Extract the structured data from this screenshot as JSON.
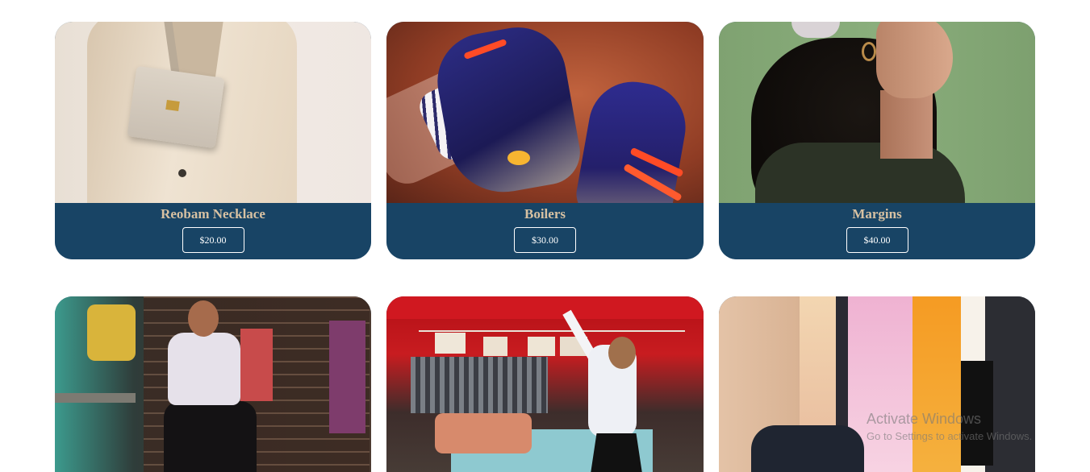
{
  "products": [
    {
      "name": "Reobam Necklace",
      "price": "$20.00"
    },
    {
      "name": "Boilers",
      "price": "$30.00"
    },
    {
      "name": "Margins",
      "price": "$40.00"
    }
  ],
  "images": [
    "jacket-bag-photo",
    "sneakers-photo",
    "woman-earring-photo",
    "market-woman-photo",
    "red-tent-market-photo",
    "scarves-photo"
  ],
  "colors": {
    "card_footer": "#184465",
    "product_name": "#d7c1a2",
    "price_text": "#ffffff",
    "page_bg": "#ffffff"
  },
  "watermark": {
    "title": "Activate Windows",
    "subtitle": "Go to Settings to activate Windows."
  }
}
